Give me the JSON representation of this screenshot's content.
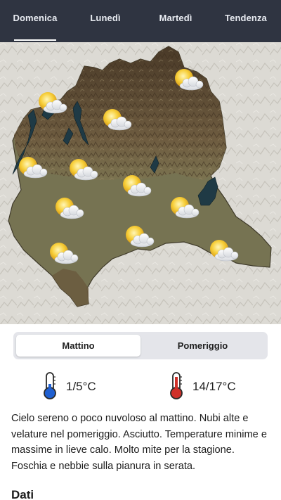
{
  "tabs": [
    {
      "label": "Domenica",
      "active": true
    },
    {
      "label": "Lunedì",
      "active": false
    },
    {
      "label": "Martedì",
      "active": false
    },
    {
      "label": "Tendenza",
      "active": false
    }
  ],
  "map": {
    "region_color": "#777452",
    "mountain_color": "#5a4a34",
    "lake_color": "#1f3a45",
    "icons": [
      "sun-behind-cloud-icon",
      "sun-behind-cloud-icon",
      "sun-behind-cloud-icon",
      "sun-behind-cloud-icon",
      "sun-behind-cloud-icon",
      "sun-behind-cloud-icon",
      "sun-behind-cloud-icon",
      "sun-behind-cloud-icon",
      "sun-behind-cloud-icon",
      "sun-behind-cloud-icon",
      "sun-behind-cloud-icon",
      "sun-behind-cloud-icon"
    ]
  },
  "period": {
    "morning_label": "Mattino",
    "afternoon_label": "Pomeriggio",
    "selected": "Mattino"
  },
  "temperatures": {
    "min": {
      "icon": "thermometer-cold-icon",
      "value": "1/5°C",
      "color": "#1f5fd0"
    },
    "max": {
      "icon": "thermometer-hot-icon",
      "value": "14/17°C",
      "color": "#d0302a"
    }
  },
  "forecast_text": "Cielo sereno o poco nuvoloso al mattino. Nubi alte e velature nel pomeriggio. Asciutto. Temperature minime e massime in lieve calo. Molto mite per la stagione. Foschia e nebbie sulla pianura in serata.",
  "section_title": "Dati"
}
